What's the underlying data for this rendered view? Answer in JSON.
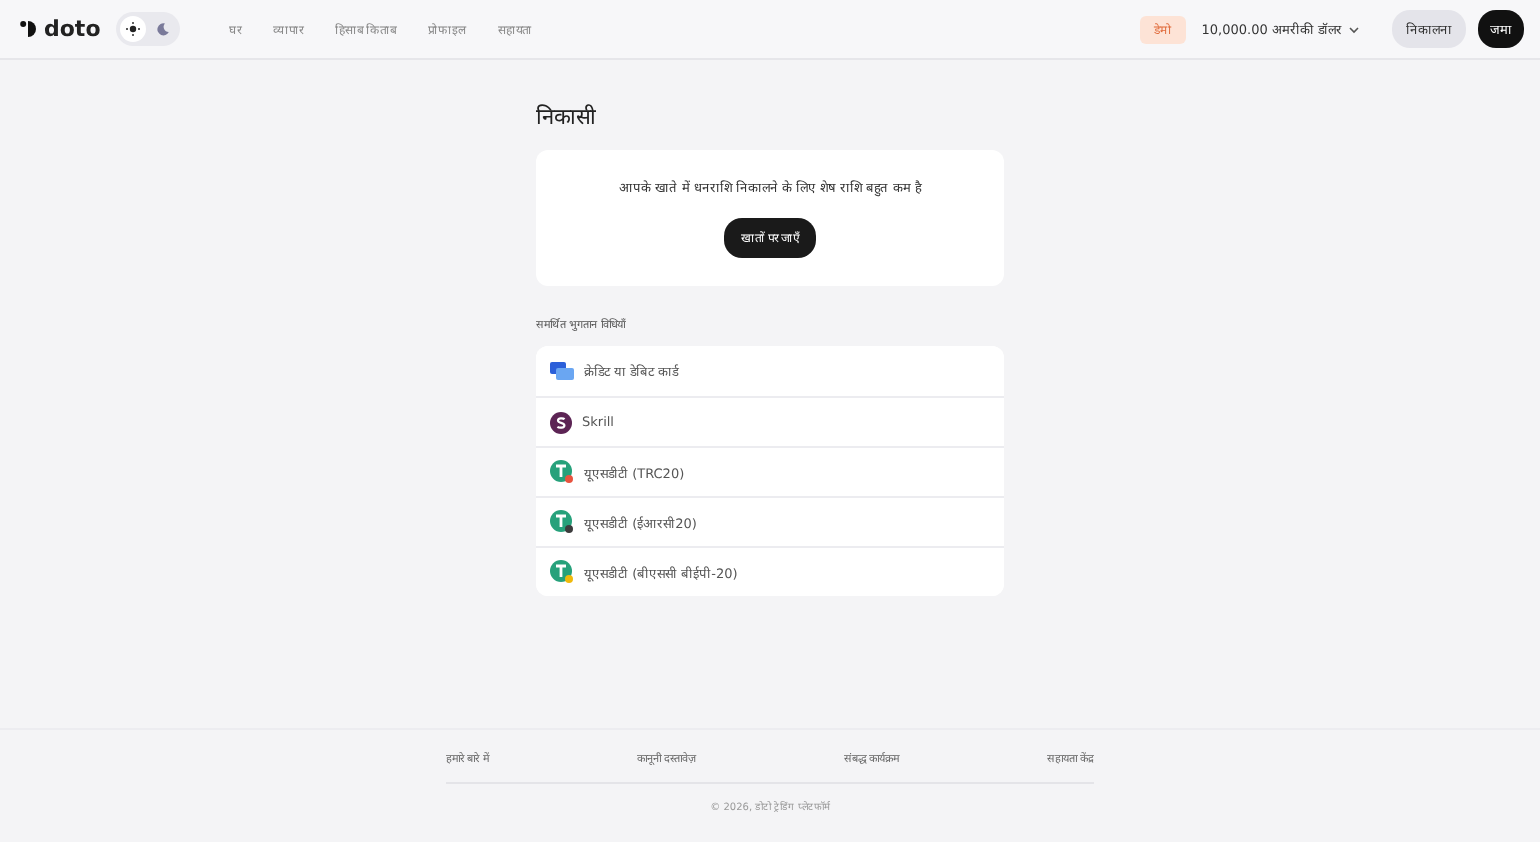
{
  "header": {
    "logo": "doto",
    "theme": [
      {
        "kind": "sun",
        "selected": true
      },
      {
        "kind": "moon",
        "selected": false
      }
    ],
    "nav": [
      "घर",
      "व्यापार",
      "हिसाब किताब",
      "प्रोफाइल",
      "सहायता"
    ],
    "account_badge": "डेमो",
    "balance": "10,000.00 अमरीकी डॉलर",
    "withdraw_button": "निकालना",
    "deposit_button": "जमा"
  },
  "page_title": "निकासी",
  "notice": {
    "message": "आपके खाते में धनराशि निकालने के लिए शेष राशि बहुत कम है",
    "button": "खातों पर जाएँ"
  },
  "methods_title": "समर्थित भुगतान विधियाँ",
  "methods": [
    {
      "kind": "card",
      "label": "क्रेडिट या डेबिट कार्ड"
    },
    {
      "kind": "skrill",
      "label": "Skrill"
    },
    {
      "kind": "tether",
      "label": "यूएसडीटी (TRC20)",
      "color": "#e8533f"
    },
    {
      "kind": "tether",
      "label": "यूएसडीटी (ईआरसी20)",
      "color": "#3c3c3d"
    },
    {
      "kind": "tether",
      "label": "यूएसडीटी (बीएससी बीईपी-20)",
      "color": "#f0b90b"
    }
  ],
  "footer": {
    "links": [
      "हमारे बारे में",
      "कानूनी दस्तावेज़",
      "संबद्ध कार्यक्रम",
      "सहायता केंद्र"
    ],
    "copyright": "© 2026, डोटो ट्रेडिंग प्लेटफॉर्म"
  }
}
